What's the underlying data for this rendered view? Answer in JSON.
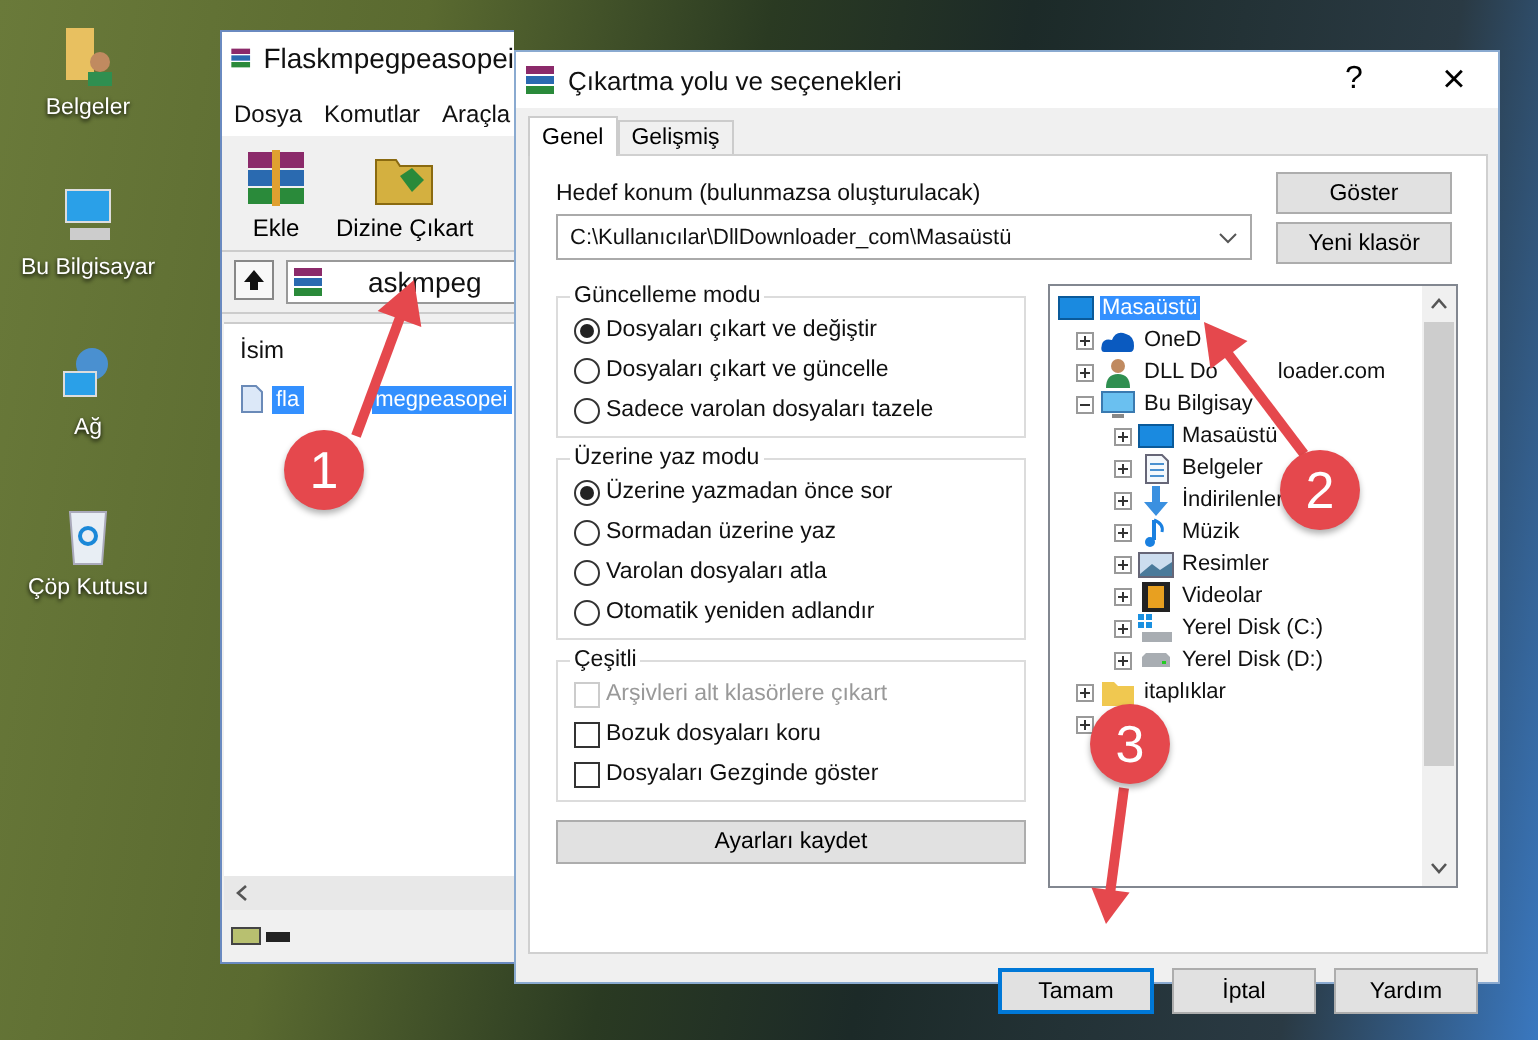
{
  "desktop_icons": [
    {
      "label": "Belgeler",
      "kind": "user-folder"
    },
    {
      "label": "Bu Bilgisayar",
      "kind": "computer"
    },
    {
      "label": "Ağ",
      "kind": "network"
    },
    {
      "label": "Çöp Kutusu",
      "kind": "recycle"
    }
  ],
  "archiver_window": {
    "title": "Flaskmpegpeasopei",
    "menu": [
      "Dosya",
      "Komutlar",
      "Araçla"
    ],
    "toolbar": [
      {
        "label": "Ekle",
        "kind": "add"
      },
      {
        "label": "Dizine Çıkart",
        "kind": "extract"
      }
    ],
    "path": "askmpeg",
    "column": "İsim",
    "files": [
      {
        "name_start": "fla",
        "name_end": "megpeasopei",
        "selected": true
      }
    ]
  },
  "dialog": {
    "title": "Çıkartma yolu ve seçenekleri",
    "help": "?",
    "close": "×",
    "tabs": [
      {
        "label": "Genel",
        "selected": true
      },
      {
        "label": "Gelişmiş",
        "selected": false
      }
    ],
    "destination_label": "Hedef konum (bulunmazsa oluşturulacak)",
    "destination_value": "C:\\Kullanıcılar\\DllDownloader_com\\Masaüstü",
    "side_buttons": [
      "Göster",
      "Yeni klasör"
    ],
    "groups": [
      {
        "title": "Güncelleme modu",
        "kind": "radio",
        "options": [
          {
            "label": "Dosyaları çıkart ve değiştir",
            "selected": true
          },
          {
            "label": "Dosyaları çıkart ve güncelle",
            "selected": false
          },
          {
            "label": "Sadece varolan dosyaları tazele",
            "selected": false
          }
        ]
      },
      {
        "title": "Üzerine yaz modu",
        "kind": "radio",
        "options": [
          {
            "label": "Üzerine yazmadan önce sor",
            "selected": true
          },
          {
            "label": "Sormadan üzerine yaz",
            "selected": false
          },
          {
            "label": "Varolan dosyaları atla",
            "selected": false
          },
          {
            "label": "Otomatik yeniden adlandır",
            "selected": false
          }
        ]
      },
      {
        "title": "Çeşitli",
        "kind": "checkbox",
        "options": [
          {
            "label": "Arşivleri alt klasörlere çıkart",
            "checked": false,
            "disabled": true
          },
          {
            "label": "Bozuk dosyaları koru",
            "checked": false,
            "disabled": false
          },
          {
            "label": "Dosyaları Gezginde göster",
            "checked": false,
            "disabled": false
          }
        ]
      }
    ],
    "save_button": "Ayarları kaydet",
    "tree": [
      {
        "label": "Masaüstü",
        "kind": "desktop",
        "selected": true,
        "children": [
          {
            "label": "OneD",
            "kind": "cloud",
            "selected": false,
            "expanded": false
          },
          {
            "label": "DLL Do",
            "label_tail": "loader.com",
            "kind": "user",
            "selected": false,
            "expanded": false
          },
          {
            "label": "Bu Bilgisay",
            "kind": "computer",
            "selected": false,
            "expanded": true,
            "children": [
              {
                "label": "Masaüstü",
                "kind": "desktop",
                "selected": false,
                "expanded": false
              },
              {
                "label": "Belgeler",
                "kind": "documents",
                "selected": false,
                "expanded": false
              },
              {
                "label": "İndirilenler",
                "kind": "download",
                "selected": false,
                "expanded": false
              },
              {
                "label": "Müzik",
                "kind": "music",
                "selected": false,
                "expanded": false
              },
              {
                "label": "Resimler",
                "kind": "pictures",
                "selected": false,
                "expanded": false
              },
              {
                "label": "Videolar",
                "kind": "video",
                "selected": false,
                "expanded": false
              },
              {
                "label": "Yerel Disk (C:)",
                "kind": "system-drive",
                "selected": false,
                "expanded": false
              },
              {
                "label": "Yerel Disk (D:)",
                "kind": "drive",
                "selected": false,
                "expanded": false
              }
            ]
          },
          {
            "label": "itaplıklar",
            "kind": "library",
            "selected": false,
            "expanded": false
          },
          {
            "kind": "hidden",
            "expanded": false
          }
        ]
      }
    ],
    "buttons": [
      {
        "label": "Tamam",
        "selected": true
      },
      {
        "label": "İptal",
        "selected": false
      },
      {
        "label": "Yardım",
        "selected": false
      }
    ]
  },
  "annotations": [
    {
      "number": "1"
    },
    {
      "number": "2"
    },
    {
      "number": "3"
    }
  ]
}
